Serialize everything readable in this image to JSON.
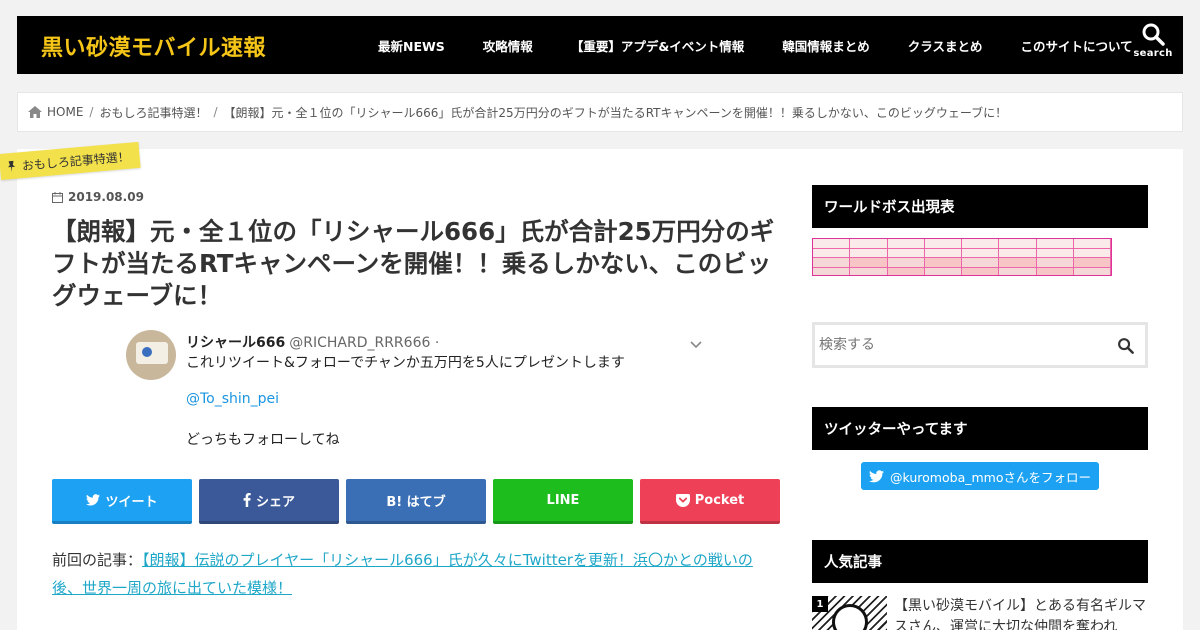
{
  "header": {
    "logo": "黒い砂漠モバイル速報",
    "nav": [
      "最新NEWS",
      "攻略情報",
      "【重要】アプデ&イベント情報",
      "韓国情報まとめ",
      "クラスまとめ",
      "このサイトについて"
    ],
    "search_label": "search"
  },
  "breadcrumb": {
    "home": "HOME",
    "category": "おもしろ記事特選！",
    "current": "【朗報】元・全１位の「リシャール666」氏が合計25万円分のギフトが当たるRTキャンペーンを開催！！乗るしかない、このビッグウェーブに！"
  },
  "article": {
    "category_badge": "おもしろ記事特選！",
    "date": "2019.08.09",
    "title": "【朗報】元・全１位の「リシャール666」氏が合計25万円分のギフトが当たるRTキャンペーンを開催！！乗るしかない、このビッグウェーブに！",
    "tweet": {
      "name": "リシャール666",
      "handle": "@RICHARD_RRR666 ·",
      "text": "これリツイート&フォローでチャンか五万円を5人にプレゼントします",
      "mention": "@To_shin_pei",
      "text2": "どっちもフォローしてね"
    },
    "share": {
      "twitter": "ツイート",
      "facebook": "シェア",
      "hatena": "B! はてブ",
      "line": "LINE",
      "pocket": "Pocket"
    },
    "prev_label": "前回の記事：",
    "prev_link": "【朗報】伝説のプレイヤー「リシャール666」氏が久々にTwitterを更新！浜〇かとの戦いの後、世界一周の旅に出ていた模様！"
  },
  "sidebar": {
    "boss_heading": "ワールドボス出現表",
    "search_placeholder": "検索する",
    "twitter_heading": "ツイッターやってます",
    "follow_button": "@kuromoba_mmoさんをフォロー",
    "popular_heading": "人気記事",
    "popular": [
      {
        "rank": "1",
        "title": "【黒い砂漠モバイル】とある有名ギルマスさん、運営に大切な仲間を奪われ"
      }
    ]
  },
  "colors": {
    "logo": "#f5c518",
    "twitter": "#1da1f2",
    "facebook": "#3b5998",
    "hatena": "#3a6fb5",
    "line": "#1dbd1d",
    "pocket": "#ee4056",
    "link": "#1fa7c8",
    "ribbon": "#f2e14b"
  }
}
